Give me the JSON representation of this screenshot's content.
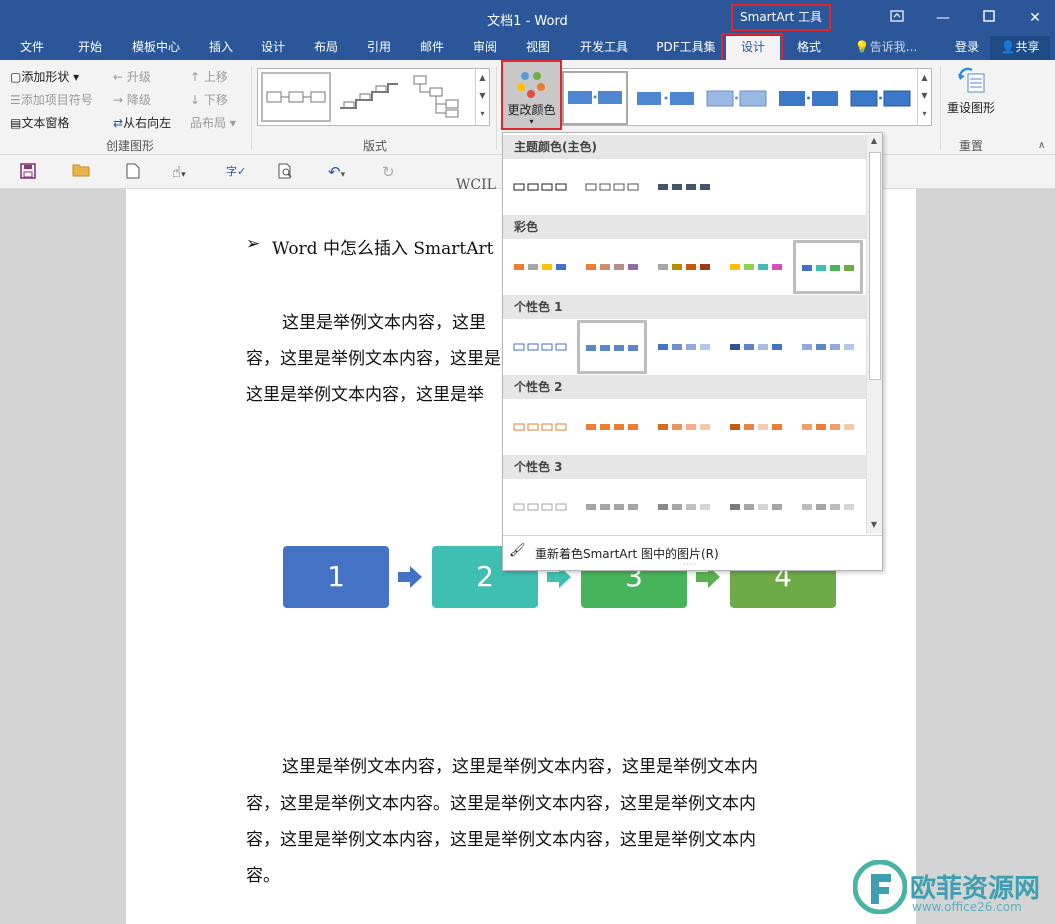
{
  "window": {
    "title": "文档1 - Word",
    "context_tab_title": "SmartArt 工具",
    "restore_icon": "ribbon-display-icon"
  },
  "tabs": [
    "文件",
    "开始",
    "模板中心",
    "插入",
    "设计",
    "布局",
    "引用",
    "邮件",
    "审阅",
    "视图",
    "开发工具",
    "PDF工具集",
    "设计",
    "格式"
  ],
  "tell_me": "告诉我...",
  "login": "登录",
  "share": "共享",
  "ribbon": {
    "create_group": {
      "add_shape": "添加形状",
      "add_bullet": "添加项目符号",
      "text_pane": "文本窗格",
      "promote": "升级",
      "demote": "降级",
      "right_to_left": "从右向左",
      "move_up": "上移",
      "move_down": "下移",
      "layout": "布局",
      "label": "创建图形"
    },
    "layouts_group": {
      "label": "版式"
    },
    "change_colors": "更改颜色",
    "reset_group": {
      "reset_graphic": "重设图形",
      "label": "重置"
    }
  },
  "document": {
    "heading_partial": "WCIL",
    "bullet": "➢",
    "heading": "Word 中怎么插入 SmartArt",
    "para1": [
      "这里是举例文本内容，这里",
      "容，这里是举例文本内容，这里是",
      "这里是举例文本内容，这里是举"
    ],
    "para2": [
      "这里是举例文本内容，这里是举例文本内容，这里是举例文本内",
      "容，这里是举例文本内容。这里是举例文本内容，这里是举例文本内",
      "容，这里是举例文本内容，这里是举例文本内容，这里是举例文本内",
      "容。"
    ],
    "smartart": [
      {
        "label": "1",
        "color": "#4472c4"
      },
      {
        "label": "2",
        "color": "#3fbfb2"
      },
      {
        "label": "3",
        "color": "#47b45c"
      },
      {
        "label": "4",
        "color": "#6eab46"
      }
    ]
  },
  "dropdown": {
    "sections": [
      "主题颜色(主色)",
      "彩色",
      "个性色 1",
      "个性色 2",
      "个性色 3"
    ],
    "footer": "重新着色SmartArt 图中的图片(R)"
  },
  "watermark": {
    "text": "欧菲资源网",
    "sub": "www.office26.com"
  }
}
